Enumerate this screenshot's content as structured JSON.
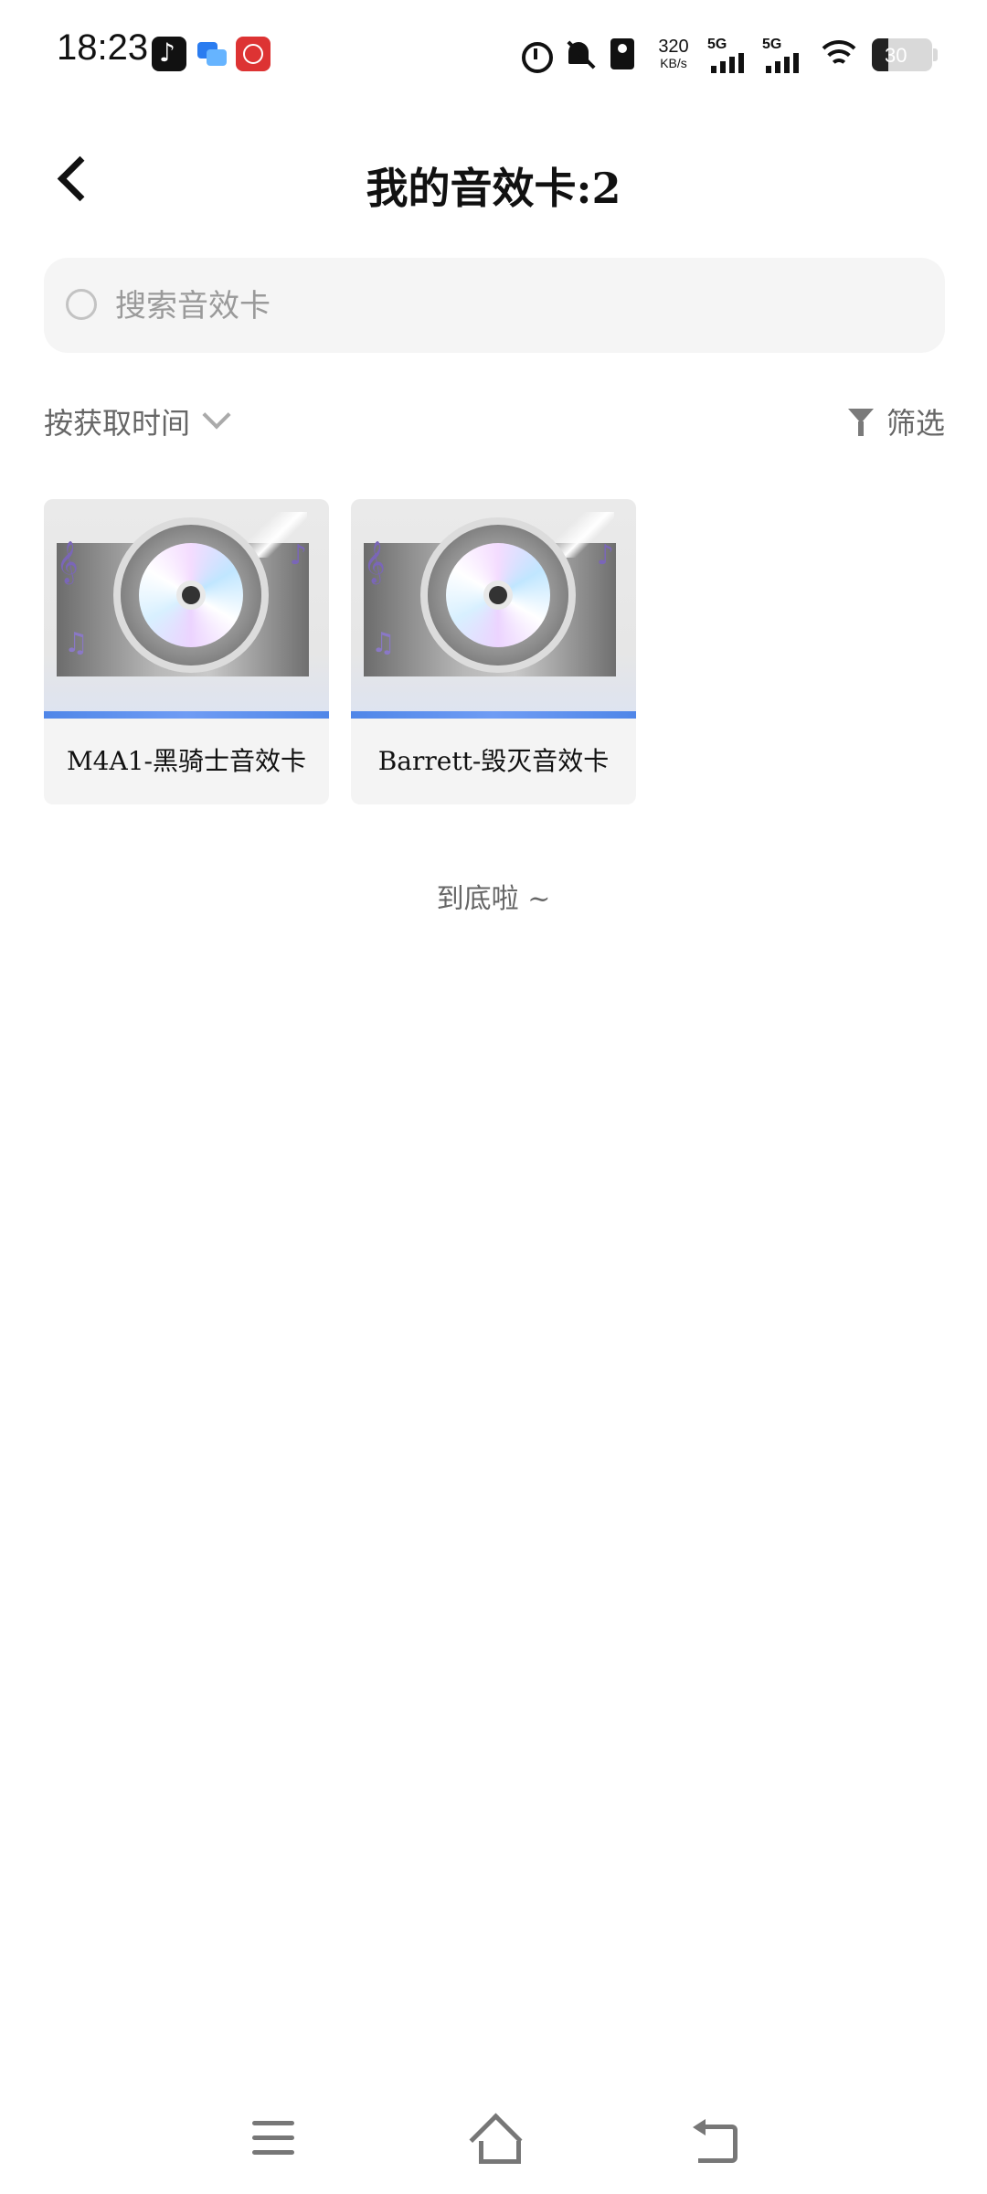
{
  "status_bar": {
    "time": "18:23",
    "net_speed_value": "320",
    "net_speed_unit": "KB/s",
    "signal_1_label": "5G",
    "signal_2_label": "5G",
    "battery_level": "30"
  },
  "header": {
    "title": "我的音效卡:2",
    "back_icon": "chevron-left-icon"
  },
  "search": {
    "placeholder": "搜索音效卡",
    "value": ""
  },
  "sort": {
    "label": "按获取时间"
  },
  "filter": {
    "label": "筛选"
  },
  "cards": [
    {
      "name": "M4A1-黑骑士音效卡"
    },
    {
      "name": "Barrett-毁灭音效卡"
    }
  ],
  "list_end_text": "到底啦 ~",
  "colors": {
    "accent_bar": "#4f86e8",
    "card_bg": "#f4f4f4",
    "search_bg": "#f5f5f5"
  }
}
